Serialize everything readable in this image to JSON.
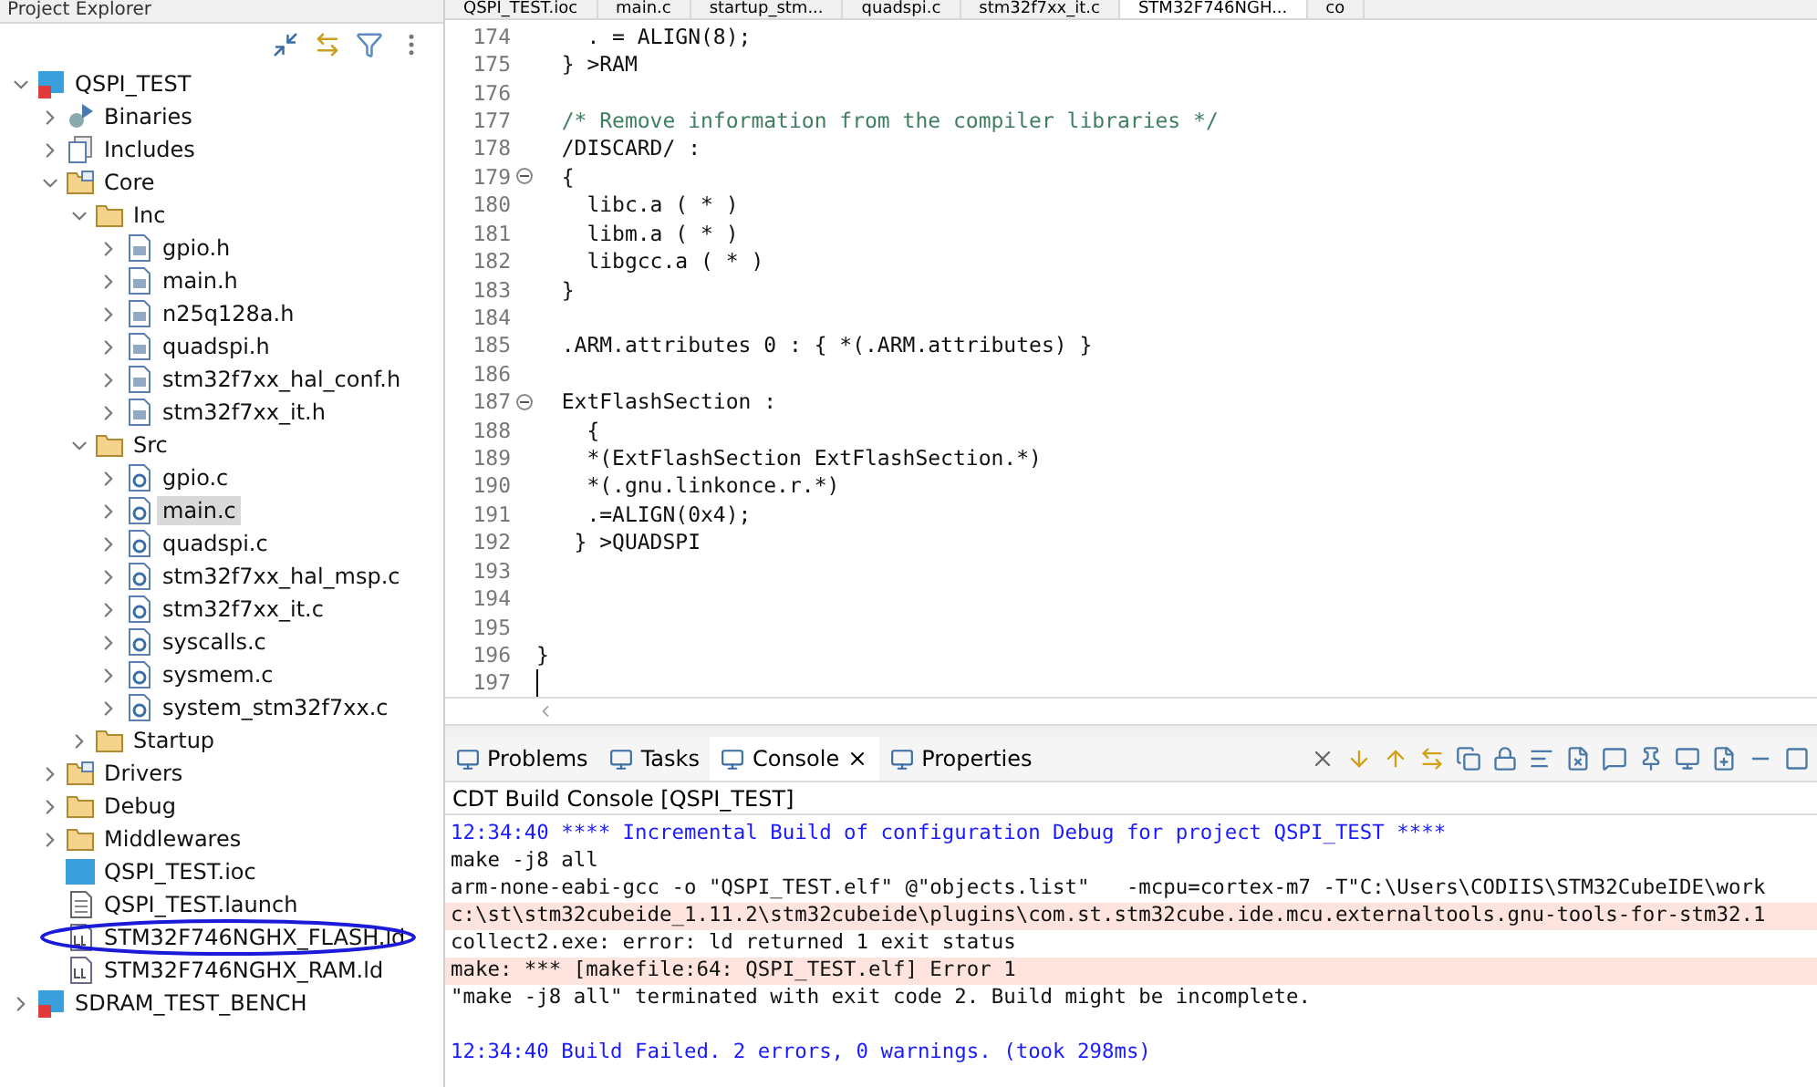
{
  "explorer": {
    "title": "Project Explorer",
    "tree": [
      {
        "label": "QSPI_TEST",
        "kind": "project",
        "expanded": true,
        "selected": false,
        "children": [
          {
            "label": "Binaries",
            "kind": "binaries",
            "expanded": false,
            "selected": false
          },
          {
            "label": "Includes",
            "kind": "includes",
            "expanded": false,
            "selected": false
          },
          {
            "label": "Core",
            "kind": "srcfolder",
            "expanded": true,
            "selected": false,
            "children": [
              {
                "label": "Inc",
                "kind": "folder",
                "expanded": true,
                "selected": false,
                "children": [
                  {
                    "label": "gpio.h",
                    "kind": "h",
                    "expanded": false,
                    "selected": false
                  },
                  {
                    "label": "main.h",
                    "kind": "h",
                    "expanded": false,
                    "selected": false
                  },
                  {
                    "label": "n25q128a.h",
                    "kind": "h",
                    "expanded": false,
                    "selected": false
                  },
                  {
                    "label": "quadspi.h",
                    "kind": "h",
                    "expanded": false,
                    "selected": false
                  },
                  {
                    "label": "stm32f7xx_hal_conf.h",
                    "kind": "h",
                    "expanded": false,
                    "selected": false
                  },
                  {
                    "label": "stm32f7xx_it.h",
                    "kind": "h",
                    "expanded": false,
                    "selected": false
                  }
                ]
              },
              {
                "label": "Src",
                "kind": "folder",
                "expanded": true,
                "selected": false,
                "children": [
                  {
                    "label": "gpio.c",
                    "kind": "c",
                    "expanded": false,
                    "selected": false
                  },
                  {
                    "label": "main.c",
                    "kind": "c",
                    "expanded": false,
                    "selected": true
                  },
                  {
                    "label": "quadspi.c",
                    "kind": "c",
                    "expanded": false,
                    "selected": false
                  },
                  {
                    "label": "stm32f7xx_hal_msp.c",
                    "kind": "c",
                    "expanded": false,
                    "selected": false
                  },
                  {
                    "label": "stm32f7xx_it.c",
                    "kind": "c",
                    "expanded": false,
                    "selected": false
                  },
                  {
                    "label": "syscalls.c",
                    "kind": "c",
                    "expanded": false,
                    "selected": false
                  },
                  {
                    "label": "sysmem.c",
                    "kind": "c",
                    "expanded": false,
                    "selected": false
                  },
                  {
                    "label": "system_stm32f7xx.c",
                    "kind": "c",
                    "expanded": false,
                    "selected": false
                  }
                ]
              },
              {
                "label": "Startup",
                "kind": "folder",
                "expanded": false,
                "selected": false
              }
            ]
          },
          {
            "label": "Drivers",
            "kind": "srcfolder",
            "expanded": false,
            "selected": false
          },
          {
            "label": "Debug",
            "kind": "folder",
            "expanded": false,
            "selected": false
          },
          {
            "label": "Middlewares",
            "kind": "folder",
            "expanded": false,
            "selected": false
          },
          {
            "label": "QSPI_TEST.ioc",
            "kind": "mx",
            "selected": false
          },
          {
            "label": "QSPI_TEST.launch",
            "kind": "launch",
            "selected": false
          },
          {
            "label": "STM32F746NGHX_FLASH.ld",
            "kind": "ld",
            "selected": false,
            "circled": true
          },
          {
            "label": "STM32F746NGHX_RAM.ld",
            "kind": "ld",
            "selected": false
          }
        ]
      },
      {
        "label": "SDRAM_TEST_BENCH",
        "kind": "project",
        "expanded": false,
        "selected": false
      }
    ]
  },
  "editor": {
    "tabs": [
      {
        "label": "QSPI_TEST.ioc",
        "selected": false
      },
      {
        "label": "main.c",
        "selected": false
      },
      {
        "label": "startup_stm...",
        "selected": false
      },
      {
        "label": "quadspi.c",
        "selected": false
      },
      {
        "label": "stm32f7xx_it.c",
        "selected": false
      },
      {
        "label": "STM32F746NGH...",
        "selected": true
      },
      {
        "label": "co",
        "selected": false
      }
    ],
    "lines": [
      {
        "number": "174",
        "text": "    . = ALIGN(8);",
        "kind": "code"
      },
      {
        "number": "175",
        "text": "  } >RAM",
        "kind": "code"
      },
      {
        "number": "176"
      },
      {
        "number": "177",
        "text": "  /* Remove information from the compiler libraries */",
        "kind": "comment"
      },
      {
        "number": "178",
        "text": "  /DISCARD/ :",
        "kind": "code"
      },
      {
        "number": "179",
        "text": "  {",
        "kind": "code",
        "fold": true
      },
      {
        "number": "180",
        "text": "    libc.a ( * )",
        "kind": "code"
      },
      {
        "number": "181",
        "text": "    libm.a ( * )",
        "kind": "code"
      },
      {
        "number": "182",
        "text": "    libgcc.a ( * )",
        "kind": "code"
      },
      {
        "number": "183",
        "text": "  }",
        "kind": "code"
      },
      {
        "number": "184"
      },
      {
        "number": "185",
        "text": "  .ARM.attributes 0 : { *(.ARM.attributes) }",
        "kind": "code"
      },
      {
        "number": "186"
      },
      {
        "number": "187",
        "text": "  ExtFlashSection :",
        "kind": "code",
        "fold": true
      },
      {
        "number": "188",
        "text": "    {",
        "kind": "code"
      },
      {
        "number": "189",
        "text": "    *(ExtFlashSection ExtFlashSection.*)",
        "kind": "code"
      },
      {
        "number": "190",
        "text": "    *(.gnu.linkonce.r.*)",
        "kind": "code"
      },
      {
        "number": "191",
        "text": "    .=ALIGN(0x4);",
        "kind": "code"
      },
      {
        "number": "192",
        "text": "   } >QUADSPI",
        "kind": "code"
      },
      {
        "number": "193"
      },
      {
        "number": "194"
      },
      {
        "number": "195"
      },
      {
        "number": "196",
        "text": "}",
        "kind": "code"
      },
      {
        "number": "197",
        "cursor": true
      }
    ]
  },
  "console": {
    "tabs": [
      {
        "label": "Problems",
        "selected": false
      },
      {
        "label": "Tasks",
        "selected": false
      },
      {
        "label": "Console",
        "selected": true
      },
      {
        "label": "Properties",
        "selected": false
      }
    ],
    "title": "CDT Build Console [QSPI_TEST]",
    "lines": [
      {
        "text": "12:34:40 **** Incremental Build of configuration Debug for project QSPI_TEST ****",
        "kind": "info"
      },
      {
        "text": "make -j8 all",
        "kind": "normal"
      },
      {
        "text": "arm-none-eabi-gcc -o \"QSPI_TEST.elf\" @\"objects.list\"   -mcpu=cortex-m7 -T\"C:\\Users\\CODIIS\\STM32CubeIDE\\work",
        "kind": "normal"
      },
      {
        "text": "c:\\st\\stm32cubeide_1.11.2\\stm32cubeide\\plugins\\com.st.stm32cube.ide.mcu.externaltools.gnu-tools-for-stm32.1",
        "kind": "error"
      },
      {
        "text": "collect2.exe: error: ld returned 1 exit status",
        "kind": "normal"
      },
      {
        "text": "make: *** [makefile:64: QSPI_TEST.elf] Error 1",
        "kind": "error"
      },
      {
        "text": "\"make -j8 all\" terminated with exit code 2. Build might be incomplete.",
        "kind": "normal"
      },
      {
        "kind": "blank"
      },
      {
        "text": "12:34:40 Build Failed. 2 errors, 0 warnings. (took 298ms)",
        "kind": "info"
      }
    ]
  }
}
